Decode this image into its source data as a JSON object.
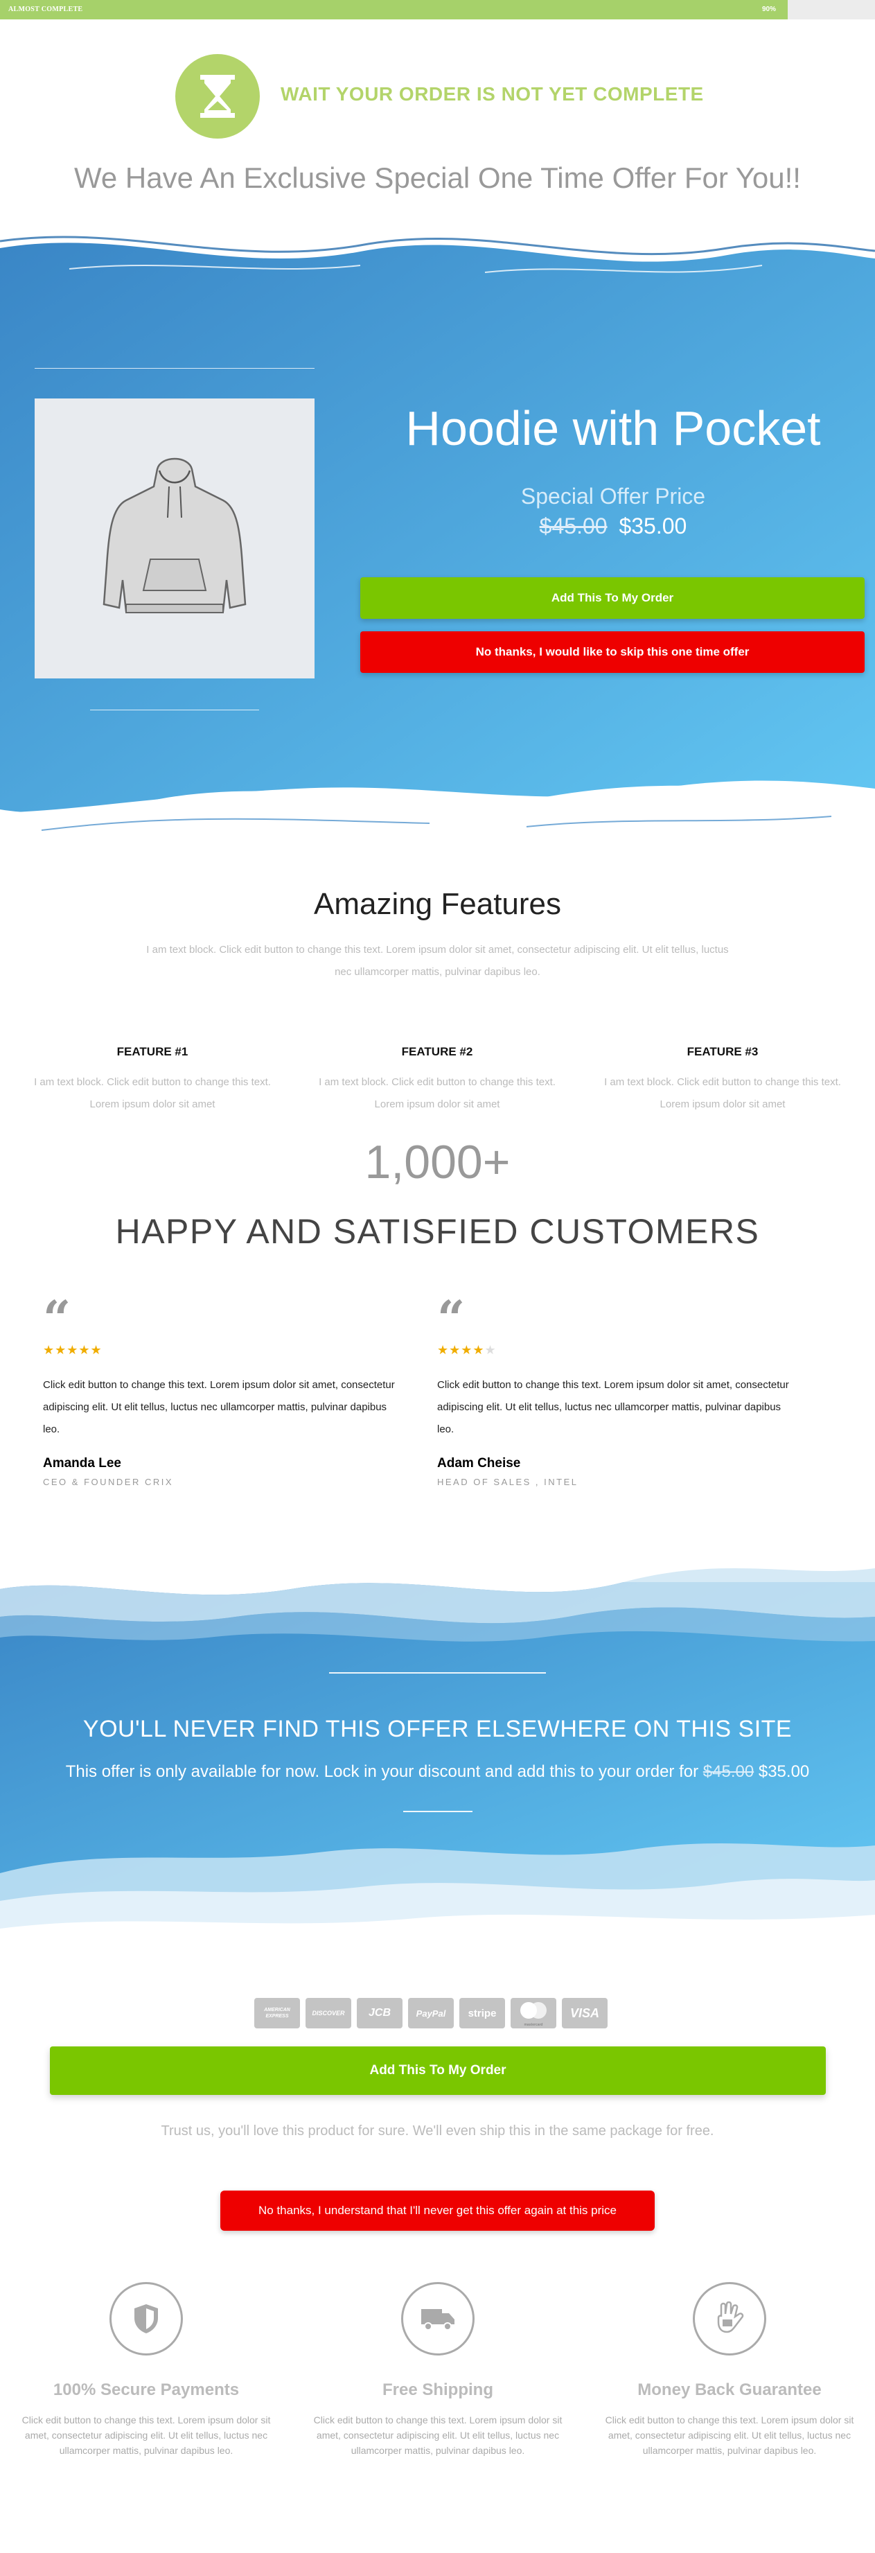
{
  "progress": {
    "label": "ALMOST COMPLETE",
    "percent_text": "90%",
    "percent": 90
  },
  "header": {
    "icon": "hourglass-icon",
    "title": "WAIT YOUR ORDER IS NOT YET COMPLETE",
    "subtitle": "We Have An Exclusive Special One Time Offer For You!!"
  },
  "offer": {
    "product_image": "hoodie-image",
    "product_title": "Hoodie with Pocket",
    "special_label": "Special Offer Price",
    "old_price": "$45.00",
    "new_price": "$35.00",
    "add_button": "Add This To My Order",
    "skip_button": "No thanks, I would like to skip this one time offer"
  },
  "features": {
    "title": "Amazing Features",
    "description": "I am text block. Click edit button to change this text. Lorem ipsum dolor sit amet, consectetur adipiscing elit. Ut elit tellus, luctus nec ullamcorper mattis, pulvinar dapibus leo.",
    "items": [
      {
        "name": "FEATURE #1",
        "text": "I am text block. Click edit button to change this text. Lorem ipsum dolor sit amet"
      },
      {
        "name": "FEATURE #2",
        "text": "I am text block. Click edit button to change this text. Lorem ipsum dolor sit amet"
      },
      {
        "name": "FEATURE #3",
        "text": "I am text block. Click edit button to change this text. Lorem ipsum dolor sit amet"
      }
    ]
  },
  "stats": {
    "number": "1,000+",
    "caption": "HAPPY AND SATISFIED CUSTOMERS"
  },
  "testimonials": [
    {
      "rating": 5,
      "stars_on": "★★★★★",
      "stars_off": "",
      "text": "Click edit button to change this text. Lorem ipsum dolor sit amet, consectetur adipiscing elit. Ut elit tellus, luctus nec ullamcorper mattis, pulvinar dapibus leo.",
      "name": "Amanda Lee",
      "role": "CEO & FOUNDER CRIX"
    },
    {
      "rating": 4,
      "stars_on": "★★★★",
      "stars_off": "★",
      "text": "Click edit button to change this text. Lorem ipsum dolor sit amet, consectetur adipiscing elit. Ut elit tellus, luctus nec ullamcorper mattis, pulvinar dapibus leo.",
      "name": "Adam Cheise",
      "role": "HEAD OF SALES , INTEL"
    }
  ],
  "offer2": {
    "title": "YOU'LL NEVER FIND THIS OFFER ELSEWHERE ON THIS SITE",
    "text": "This offer is only available for now. Lock in your discount and add this to your order for",
    "old_price": "$45.00",
    "new_price": "$35.00"
  },
  "cta": {
    "cards": [
      "AMERICAN EXPRESS",
      "DISCOVER",
      "JCB",
      "PayPal",
      "stripe",
      "mastercard",
      "VISA"
    ],
    "add_button": "Add This To My Order",
    "text": "Trust us, you'll love this product for sure. We'll even ship this in the same package for free.",
    "skip_button": "No thanks, I understand that I'll never get this offer again at this price"
  },
  "guarantees": [
    {
      "icon": "shield-icon",
      "title": "100% Secure Payments",
      "text": "Click edit button to change this text. Lorem ipsum dolor sit amet, consectetur adipiscing elit. Ut elit tellus, luctus nec ullamcorper mattis, pulvinar dapibus leo."
    },
    {
      "icon": "truck-icon",
      "title": "Free Shipping",
      "text": "Click edit button to change this text. Lorem ipsum dolor sit amet, consectetur adipiscing elit. Ut elit tellus, luctus nec ullamcorper mattis, pulvinar dapibus leo."
    },
    {
      "icon": "hand-money-icon",
      "title": "Money Back Guarantee",
      "text": "Click edit button to change this text. Lorem ipsum dolor sit amet, consectetur adipiscing elit. Ut elit tellus, luctus nec ullamcorper mattis, pulvinar dapibus leo."
    }
  ],
  "colors": {
    "accent_green": "#a6d16a",
    "button_green": "#7ac600",
    "button_red": "#ee0000",
    "blue": "#3f8fcf"
  }
}
